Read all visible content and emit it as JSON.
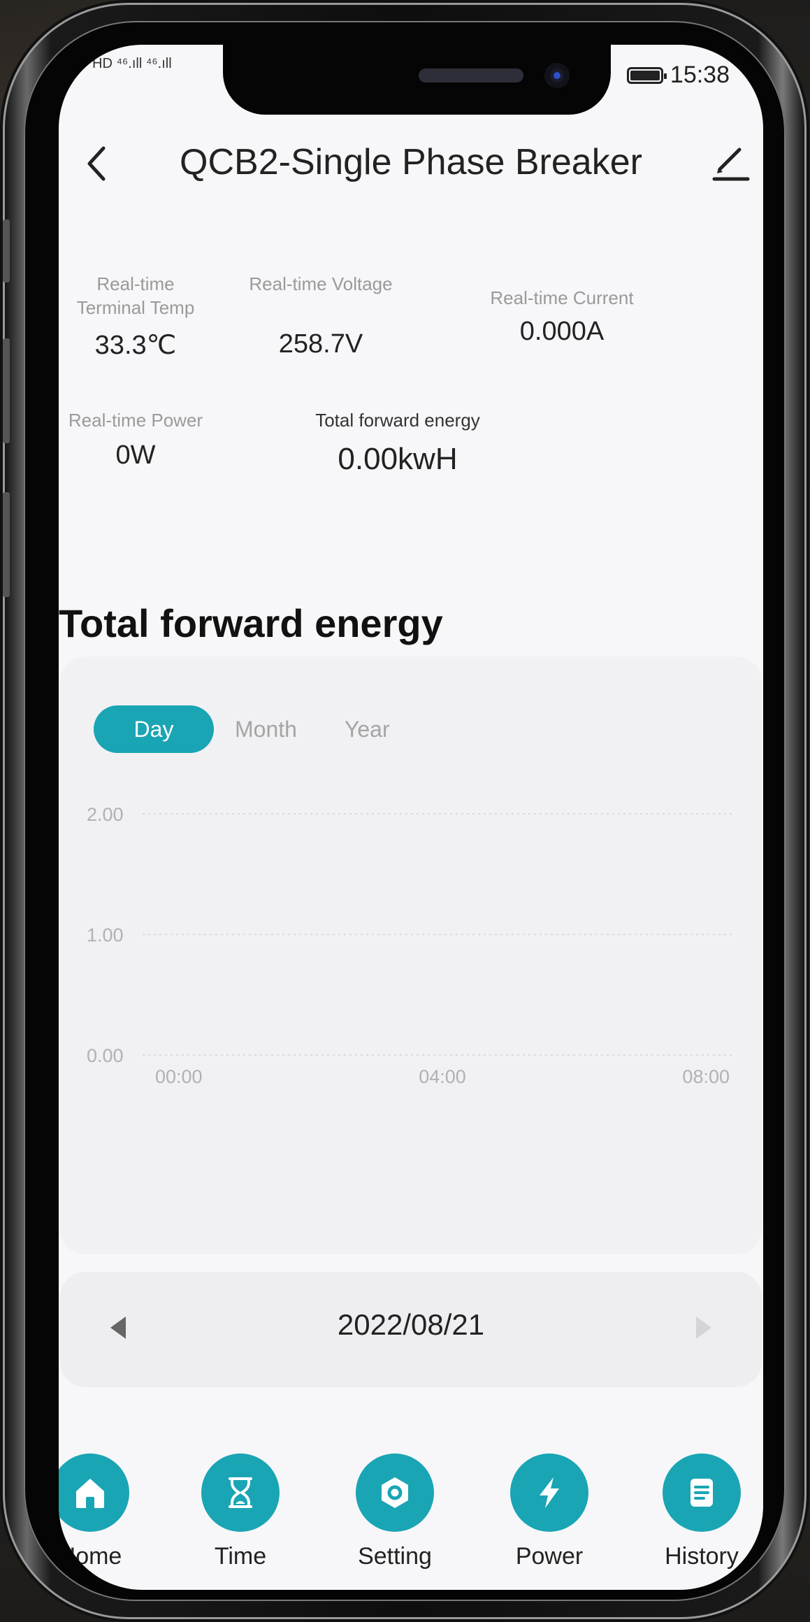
{
  "status_bar": {
    "left_text": "HD ⁴⁶.ıll ⁴⁶.ıll",
    "time": "15:38"
  },
  "header": {
    "title": "QCB2-Single Phase Breaker"
  },
  "metrics": {
    "terminal_temp": {
      "label_line1": "Real-time",
      "label_line2": "Terminal Temp",
      "value": "33.3℃"
    },
    "voltage": {
      "label": "Real-time Voltage",
      "value": "258.7V"
    },
    "current": {
      "label": "Real-time Current",
      "value": "0.000A"
    },
    "power": {
      "label": "Real-time Power",
      "value": "0W"
    },
    "total_energy": {
      "label": "Total forward energy",
      "value": "0.00kwH"
    }
  },
  "section": {
    "title": "Total forward energy"
  },
  "tabs": [
    {
      "label": "Day",
      "active": true
    },
    {
      "label": "Month",
      "active": false
    },
    {
      "label": "Year",
      "active": false
    }
  ],
  "chart_data": {
    "type": "line",
    "title": "",
    "xlabel": "",
    "ylabel": "",
    "x_ticks": [
      "00:00",
      "04:00",
      "08:00"
    ],
    "y_ticks": [
      "0.00",
      "1.00",
      "2.00"
    ],
    "ylim": [
      0,
      2
    ],
    "series": [],
    "grid": "dotted horizontal",
    "colors": {
      "grid": "#d9d9de",
      "tick": "#b0b0b6"
    }
  },
  "date_nav": {
    "date": "2022/08/21"
  },
  "bottom_nav": [
    {
      "label": "Home",
      "icon": "home-icon"
    },
    {
      "label": "Time",
      "icon": "hourglass-icon"
    },
    {
      "label": "Setting",
      "icon": "settings-hex-icon"
    },
    {
      "label": "Power",
      "icon": "lightning-icon"
    },
    {
      "label": "History",
      "icon": "document-icon"
    }
  ],
  "colors": {
    "accent": "#1aa5b4",
    "screen_bg": "#f7f7f9",
    "card_bg": "#f1f1f4"
  }
}
